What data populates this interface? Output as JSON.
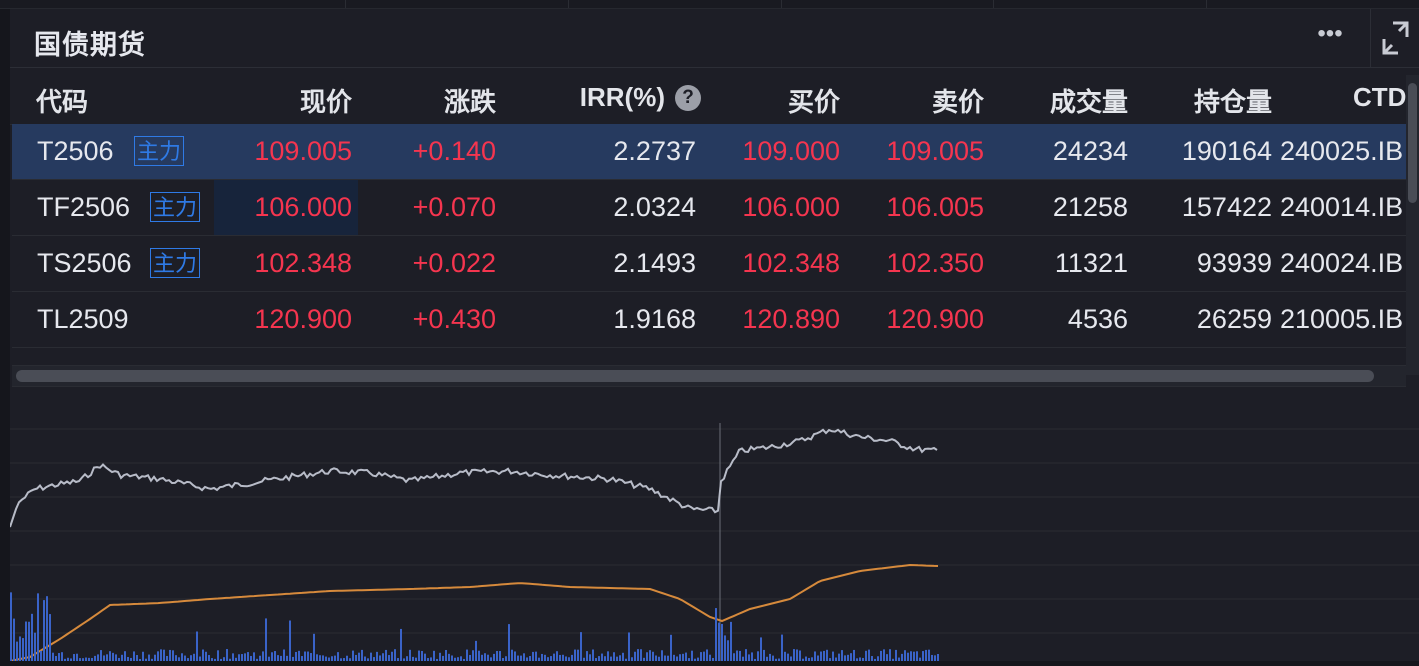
{
  "panel": {
    "title": "国债期货",
    "more_label": "•••"
  },
  "columns": {
    "code": "代码",
    "price": "现价",
    "change": "涨跌",
    "irr": "IRR(%)",
    "bid": "买价",
    "ask": "卖价",
    "volume": "成交量",
    "oi": "持仓量",
    "ctd": "CTD"
  },
  "help_label": "?",
  "rows": [
    {
      "code": "T2506",
      "tag": "主力",
      "price": "109.005",
      "change": "+0.140",
      "irr": "2.2737",
      "bid": "109.000",
      "ask": "109.005",
      "volume": "24234",
      "oi": "190164",
      "ctd": "240025.IB"
    },
    {
      "code": "TF2506",
      "tag": "主力",
      "price": "106.000",
      "change": "+0.070",
      "irr": "2.0324",
      "bid": "106.000",
      "ask": "106.005",
      "volume": "21258",
      "oi": "157422",
      "ctd": "240014.IB"
    },
    {
      "code": "TS2506",
      "tag": "主力",
      "price": "102.348",
      "change": "+0.022",
      "irr": "2.1493",
      "bid": "102.348",
      "ask": "102.350",
      "volume": "11321",
      "oi": "93939",
      "ctd": "240024.IB"
    },
    {
      "code": "TL2509",
      "tag": "",
      "price": "120.900",
      "change": "+0.430",
      "irr": "1.9168",
      "bid": "120.890",
      "ask": "120.900",
      "volume": "4536",
      "oi": "26259",
      "ctd": "210005.IB"
    }
  ],
  "colors": {
    "up": "#f5354f",
    "tag": "#2f7ae5",
    "price_line": "#b8bcc8",
    "avg_line": "#d68a3c",
    "volume_bar": "#3a63c8",
    "selected_row": "#263a5f"
  },
  "icons": {
    "more": "more-dots-icon",
    "expand": "expand-icon",
    "help": "help-circle-icon"
  }
}
